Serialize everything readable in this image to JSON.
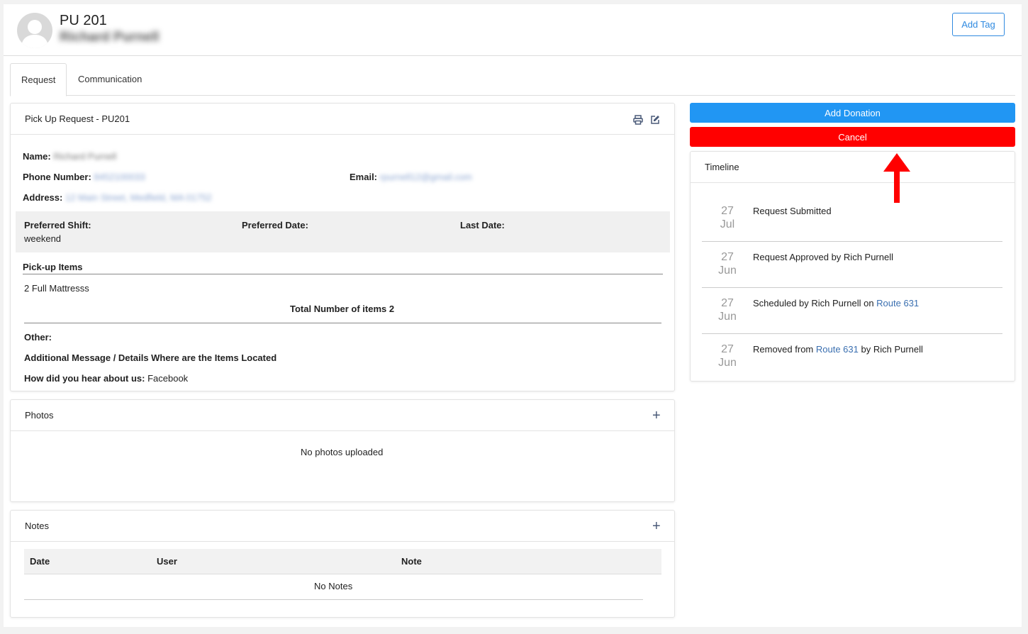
{
  "header": {
    "title": "PU 201",
    "name": "Richard Purnell",
    "add_tag_label": "Add Tag"
  },
  "tabs": [
    "Request",
    "Communication"
  ],
  "request_card": {
    "title": "Pick Up Request - PU201",
    "name_label": "Name:",
    "name_value": "Richard Purnell",
    "phone_label": "Phone Number:",
    "phone_value": "8452100033",
    "email_label": "Email:",
    "email_value": "rpurnell12@gmail.com",
    "address_label": "Address:",
    "address_value": "12 Main Street, Medfield, MA 01752",
    "shift_label": "Preferred Shift:",
    "shift_value": "weekend",
    "date_label": "Preferred Date:",
    "last_date_label": "Last Date:",
    "items_heading": "Pick-up Items",
    "items": [
      "2 Full Mattresss"
    ],
    "total_label": "Total Number of items 2",
    "other_label": "Other:",
    "message_label": "Additional Message / Details Where are the Items Located",
    "hear_label": "How did you hear about us:",
    "hear_value": "Facebook"
  },
  "photos_card": {
    "title": "Photos",
    "empty": "No photos uploaded"
  },
  "notes_card": {
    "title": "Notes",
    "columns": [
      "Date",
      "User",
      "Note"
    ],
    "empty": "No Notes"
  },
  "actions": {
    "add_donation": "Add Donation",
    "cancel": "Cancel"
  },
  "timeline": {
    "title": "Timeline",
    "items": [
      {
        "day": "27",
        "month": "Jul",
        "text": "Request Submitted"
      },
      {
        "day": "27",
        "month": "Jun",
        "text": "Request Approved by Rich Purnell"
      },
      {
        "day": "27",
        "month": "Jun",
        "pre": "Scheduled by Rich Purnell on ",
        "link": "Route 631",
        "post": ""
      },
      {
        "day": "27",
        "month": "Jun",
        "pre": "Removed from ",
        "link": "Route 631",
        "post": " by Rich Purnell"
      }
    ]
  },
  "colors": {
    "primary": "#2f8ae0",
    "add_donation": "#2196f3",
    "cancel": "#ff0000",
    "annotation_arrow": "#ff0000",
    "link": "#3a6fb0"
  },
  "icons": [
    "user-avatar-icon",
    "print-icon",
    "edit-icon",
    "plus-icon",
    "up-arrow-annotation-icon"
  ]
}
